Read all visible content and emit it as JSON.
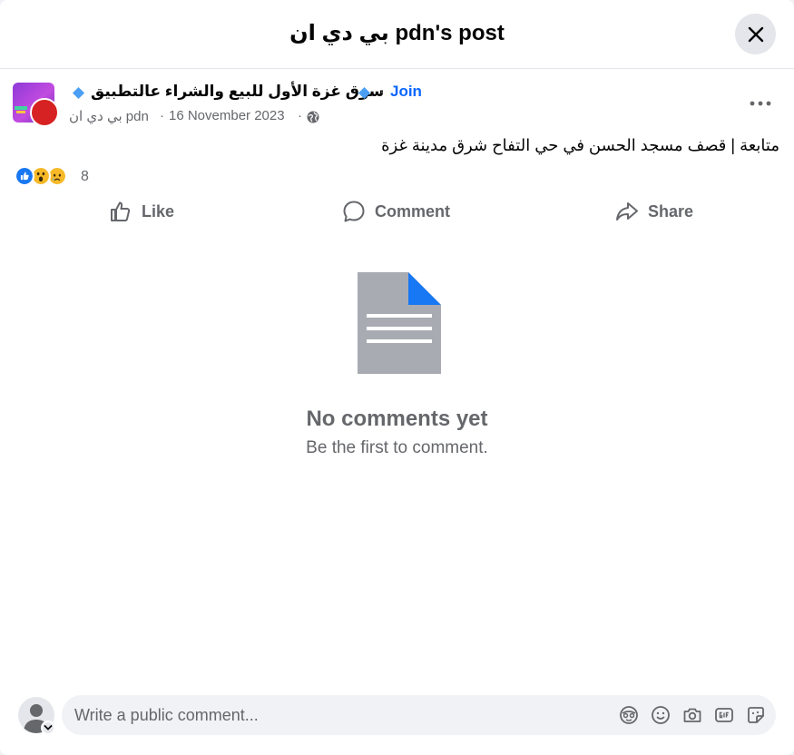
{
  "header": {
    "title": "بي دي ان pdn's post",
    "close_icon": "close-icon"
  },
  "post": {
    "group_name": "سوق غزة الأول للبيع والشراء عالتطبيق",
    "separator": "·",
    "join_label": "Join",
    "author": "بي دي ان pdn",
    "date": "16 November 2023",
    "privacy_icon": "globe-icon",
    "more_icon": "more-horizontal-icon",
    "text": "متابعة | قصف مسجد الحسن في حي التفاح شرق مدينة غزة",
    "reactions": {
      "types": [
        "like",
        "wow",
        "sad"
      ],
      "count": "8"
    }
  },
  "actions": {
    "like_label": "Like",
    "comment_label": "Comment",
    "share_label": "Share"
  },
  "comments": {
    "empty_title": "No comments yet",
    "empty_subtitle": "Be the first to comment."
  },
  "composer": {
    "placeholder": "Write a public comment...",
    "tools": [
      "avatar-sticker-icon",
      "emoji-icon",
      "camera-icon",
      "gif-icon",
      "sticker-icon"
    ]
  },
  "colors": {
    "accent": "#0866ff",
    "secondary_text": "#65676b",
    "badge": "#4a9ff5",
    "icon_gray": "#a8abb2"
  }
}
